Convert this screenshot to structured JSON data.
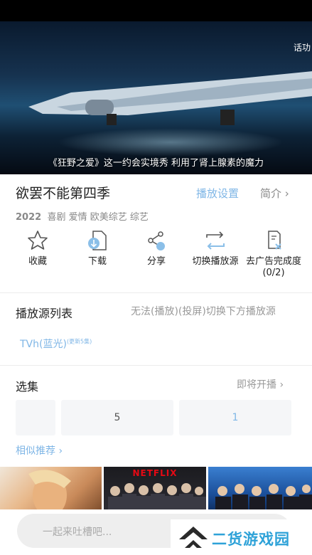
{
  "video": {
    "subtitle": "《狂野之爱》这一约会实境秀 利用了肾上腺素的魔力",
    "corner_text": "话功"
  },
  "title": {
    "show_name": "欲罢不能第四季",
    "settings_label": "播放设置",
    "intro_label": "简介 ›"
  },
  "meta": {
    "year": "2022",
    "tags": "喜剧 爱情 欧美综艺 综艺"
  },
  "actions": [
    {
      "label": "收藏",
      "icon": "star-icon"
    },
    {
      "label": "下载",
      "icon": "download-icon"
    },
    {
      "label": "分享",
      "icon": "share-icon"
    },
    {
      "label": "切换播放源",
      "icon": "switch-icon"
    },
    {
      "label": "去广告完成度",
      "sub": "(0/2)",
      "icon": "ad-block-icon"
    }
  ],
  "source": {
    "title": "播放源列表",
    "hint": "无法(播放)(投屏)切换下方播放源",
    "chip_label": "TVh(蓝光)",
    "chip_badge": "(更新5集)"
  },
  "episodes": {
    "title": "选集",
    "soon_label": "即将开播 ›",
    "cells": [
      "",
      "5",
      "1"
    ]
  },
  "recommend": {
    "title": "相似推荐 ›",
    "netflix_logo": "NETFLIX"
  },
  "comment": {
    "placeholder": "一起来吐槽吧..."
  },
  "watermark": {
    "text": "二货游戏园"
  },
  "colors": {
    "accent": "#7fb6e6",
    "muted": "#999999",
    "text": "#222222"
  }
}
